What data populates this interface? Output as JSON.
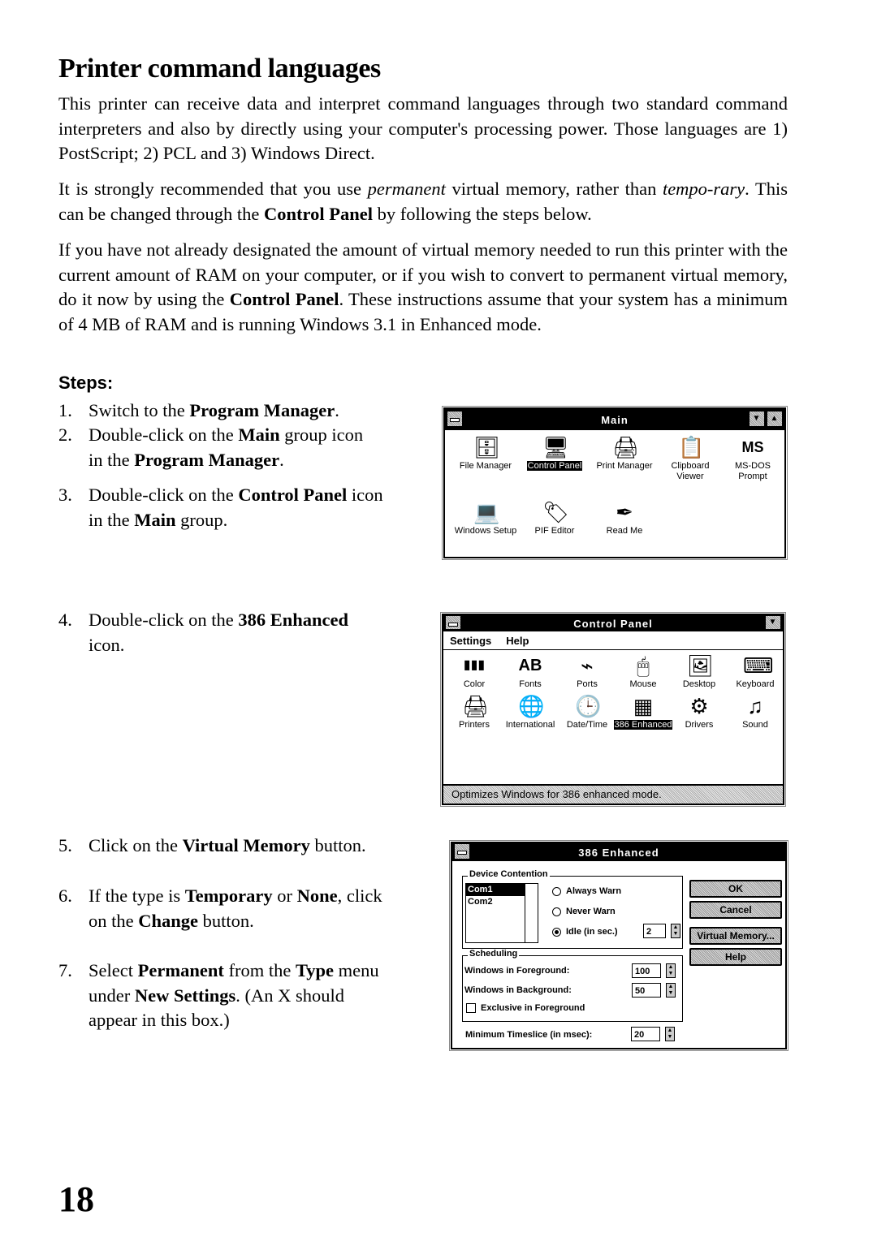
{
  "document": {
    "title": "Printer command languages",
    "paragraphs": [
      {
        "html": "This printer can receive data and interpret command languages through two standard command interpreters and also by directly using your computer's processing power.  Those languages are 1) PostScript; 2) PCL and 3) Windows Direct."
      },
      {
        "html": "It is strongly recommended that you use <i>permanent</i> virtual memory, rather than <i>tempo-rary</i>.  This can be changed through the <b>Control Panel</b> by following the steps below."
      },
      {
        "html": "If you have not already designated the amount of virtual memory needed to run this printer with the current amount of RAM on your computer, or if you wish to convert to permanent virtual memory, do it now by using the <b>Control Panel</b>.  These instructions assume that your system has a minimum of 4 MB of RAM and is running Windows 3.1 in Enhanced mode."
      }
    ],
    "steps_heading": "Steps:",
    "steps": [
      {
        "num": "1.",
        "html": "Switch to the <b>Program Manager</b>."
      },
      {
        "num": "2.",
        "html": "Double-click on the <b>Main</b> group icon<br>in the <b>Program Manager</b>."
      },
      {
        "num": "3.",
        "html": "Double-click on the <b>Control Panel</b> icon<br>in the <b>Main</b> group."
      },
      {
        "num": "4.",
        "html": "Double-click on the <b>386 Enhanced</b><br>icon."
      },
      {
        "num": "5.",
        "html": "Click on the <b>Virtual Memory</b> button."
      },
      {
        "num": "6.",
        "html": "If the type is <b>Temporary</b> or <b>None</b>, click<br>on the <b>Change</b> button."
      },
      {
        "num": "7.",
        "html": "Select <b>Permanent</b> from the <b>Type</b> menu<br>under <b>New Settings</b>.  (An X should<br>appear in this box.)"
      }
    ],
    "page_number": "18"
  },
  "main_window": {
    "title": "Main",
    "minimize": "▼",
    "maximize": "▲",
    "icons": [
      {
        "label": "File Manager",
        "glyph": "🗄",
        "selected": false
      },
      {
        "label": "Control Panel",
        "glyph": "🖥",
        "selected": true
      },
      {
        "label": "Print Manager",
        "glyph": "🖨",
        "selected": false
      },
      {
        "label": "Clipboard Viewer",
        "glyph": "📋",
        "selected": false
      },
      {
        "label": "MS-DOS Prompt",
        "glyph": "MS",
        "selected": false
      },
      {
        "label": "Windows Setup",
        "glyph": "💻",
        "selected": false
      },
      {
        "label": "PIF Editor",
        "glyph": "🏷",
        "selected": false
      },
      {
        "label": "Read Me",
        "glyph": "✒",
        "selected": false
      }
    ]
  },
  "control_panel": {
    "title": "Control Panel",
    "menu": [
      "Settings",
      "Help"
    ],
    "icons": [
      {
        "label": "Color",
        "glyph": "▮▮▮",
        "selected": false
      },
      {
        "label": "Fonts",
        "glyph": "A͏B",
        "selected": false
      },
      {
        "label": "Ports",
        "glyph": "⌁",
        "selected": false
      },
      {
        "label": "Mouse",
        "glyph": "🖱",
        "selected": false
      },
      {
        "label": "Desktop",
        "glyph": "🖼",
        "selected": false
      },
      {
        "label": "Keyboard",
        "glyph": "⌨",
        "selected": false
      },
      {
        "label": "Printers",
        "glyph": "🖨",
        "selected": false
      },
      {
        "label": "International",
        "glyph": "🌐",
        "selected": false
      },
      {
        "label": "Date/Time",
        "glyph": "🕒",
        "selected": false
      },
      {
        "label": "386 Enhanced",
        "glyph": "▦",
        "selected": true
      },
      {
        "label": "Drivers",
        "glyph": "⚙",
        "selected": false
      },
      {
        "label": "Sound",
        "glyph": "♫",
        "selected": false
      }
    ],
    "status": "Optimizes Windows for 386 enhanced mode."
  },
  "enhanced_dialog": {
    "title": "386 Enhanced",
    "device_contention": {
      "label": "Device Contention",
      "ports": [
        "Com1",
        "Com2"
      ],
      "selected_port": "Com1",
      "options": [
        {
          "label": "Always Warn",
          "checked": false
        },
        {
          "label": "Never Warn",
          "checked": false
        },
        {
          "label": "Idle (in sec.)",
          "checked": true
        }
      ],
      "idle_value": "2"
    },
    "scheduling": {
      "label": "Scheduling",
      "foreground_label": "Windows in Foreground:",
      "foreground_value": "100",
      "background_label": "Windows in Background:",
      "background_value": "50",
      "exclusive_label": "Exclusive in Foreground",
      "exclusive_checked": false
    },
    "timeslice_label": "Minimum Timeslice (in msec):",
    "timeslice_value": "20",
    "buttons": {
      "ok": "OK",
      "cancel": "Cancel",
      "virtual_memory": "Virtual Memory...",
      "help": "Help"
    }
  }
}
